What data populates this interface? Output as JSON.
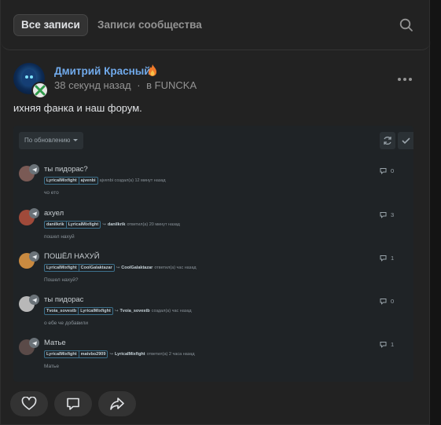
{
  "tabs": {
    "all_label": "Все записи",
    "community_label": "Записи сообщества"
  },
  "post": {
    "author": "Дмитрий Красный",
    "time": "38 секунд назад",
    "separator": "·",
    "location": "в FUNCKA",
    "text": "ихняя фанка и наш форум."
  },
  "forum": {
    "sort_label": "По обновлению",
    "threads": [
      {
        "title": "ты пидорас?",
        "tags": [
          "LyricalMixfight",
          "ajvenbi"
        ],
        "action": "ajvenbi создал(а) 12 минут назад",
        "reply_user": "",
        "preview": "чо ето",
        "count": "0",
        "avatar_color": "#7a5a55"
      },
      {
        "title": "ахуел",
        "tags": [
          "danilkrik",
          "LyricalMixfight"
        ],
        "action": "ответил(а) 20 минут назад",
        "reply_user": "danilkrik",
        "preview": "пошел нахуй",
        "count": "3",
        "avatar_color": "#a04a3a"
      },
      {
        "title": "ПОШЁЛ НАХУЙ",
        "tags": [
          "LyricalMixfight",
          "CoolGalaktazar"
        ],
        "action": "ответил(а) час назад",
        "reply_user": "CoolGalaktazar",
        "preview": "Пошел нахуй?",
        "count": "1",
        "avatar_color": "#c98a40"
      },
      {
        "title": "ты пидорас",
        "tags": [
          "Tvoia_sovestb",
          "LyricalMixfight"
        ],
        "action": "создал(а) час назад",
        "reply_user": "Tvoia_sovestb",
        "preview": "о ебе че добавили",
        "count": "0",
        "avatar_color": "#b8b8b8"
      },
      {
        "title": "Матье",
        "tags": [
          "LyricalMixfight",
          "matvbo2909"
        ],
        "action": "ответил(а) 2 часа назад",
        "reply_user": "LyricalMixfight",
        "preview": "Матье",
        "count": "1",
        "avatar_color": "#5a4a48"
      }
    ]
  },
  "colors": {
    "accent": "#71aaeb",
    "background": "#222222",
    "page": "#141414"
  },
  "icons": [
    "search-icon",
    "fire-icon",
    "more-icon",
    "refresh-icon",
    "check-icon",
    "telegram-icon",
    "comment-icon",
    "like-icon",
    "share-icon"
  ]
}
